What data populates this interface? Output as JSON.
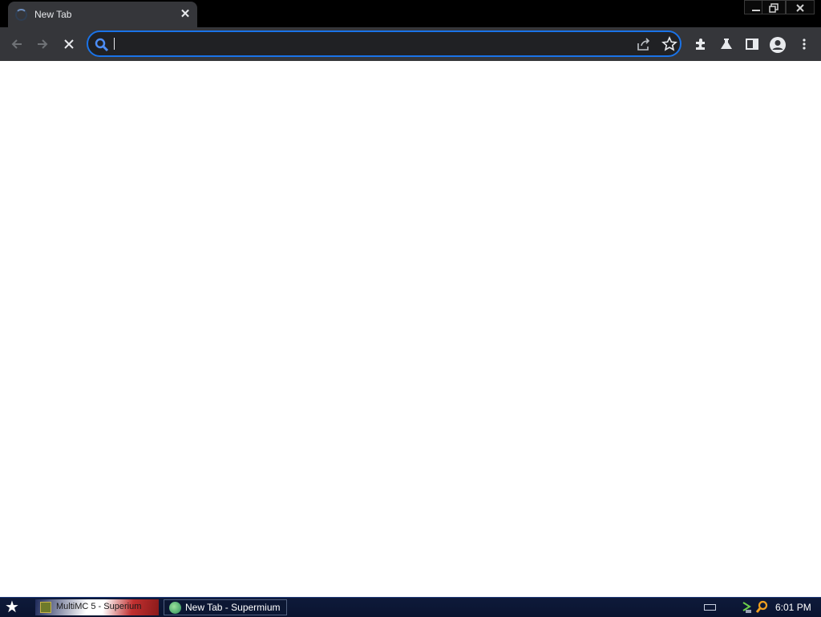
{
  "browser": {
    "tab": {
      "title": "New Tab",
      "close_glyph": "✕"
    },
    "window_controls": {
      "minimize": "—",
      "restore": "❐",
      "close": "✕"
    },
    "omnibox": {
      "value": "",
      "placeholder": ""
    },
    "accent_color": "#1a73e8"
  },
  "taskbar": {
    "items": [
      {
        "label": "MultiMC 5 - Superium",
        "icon": "multimc-icon"
      },
      {
        "label": "New Tab - Supermium",
        "icon": "supermium-icon"
      }
    ],
    "clock": "6:01 PM"
  }
}
